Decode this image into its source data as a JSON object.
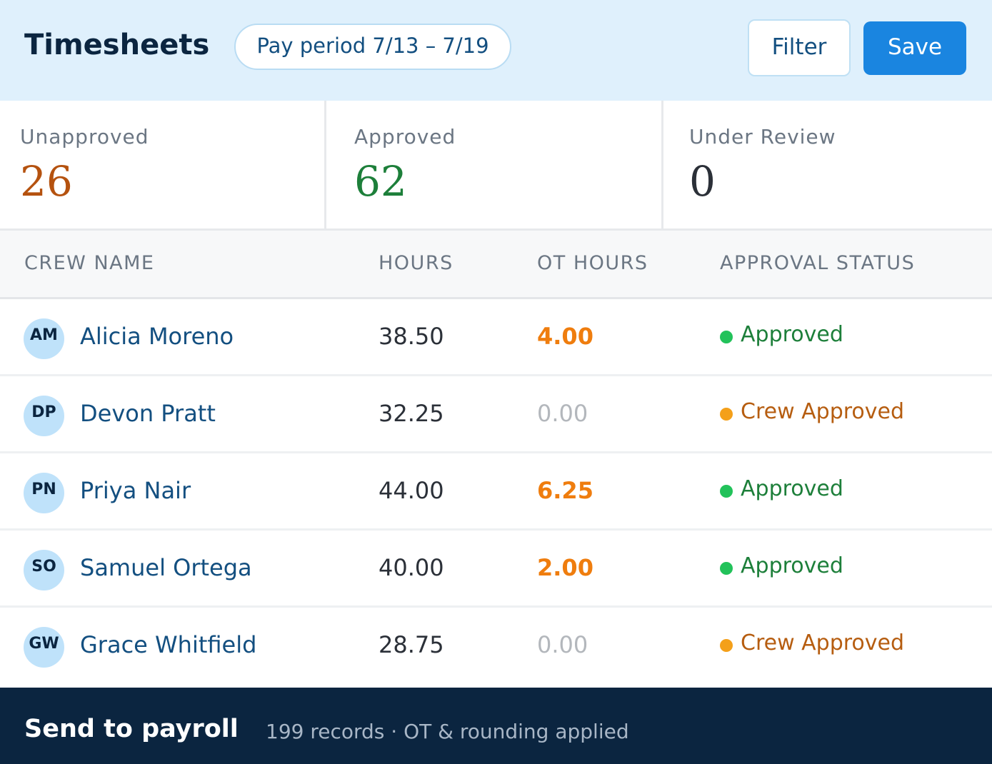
{
  "header": {
    "title": "Timesheets",
    "pay_period": "Pay period 7/13 – 7/19",
    "filter_label": "Filter",
    "save_label": "Save"
  },
  "stats": [
    {
      "label": "Unapproved",
      "value": "26",
      "color": "#b5520f"
    },
    {
      "label": "Approved",
      "value": "62",
      "color": "#1d7f3a"
    },
    {
      "label": "Under Review",
      "value": "0",
      "color": "#2b3038"
    }
  ],
  "table": {
    "columns": [
      "CREW NAME",
      "HOURS",
      "OT HOURS",
      "APPROVAL STATUS"
    ],
    "rows": [
      {
        "initials": "AM",
        "name": "Alicia Moreno",
        "hours": "38.50",
        "ot": "4.00",
        "status": "Approved"
      },
      {
        "initials": "DP",
        "name": "Devon Pratt",
        "hours": "32.25",
        "ot": "0.00",
        "status": "Crew Approved"
      },
      {
        "initials": "PN",
        "name": "Priya Nair",
        "hours": "44.00",
        "ot": "6.25",
        "status": "Approved"
      },
      {
        "initials": "SO",
        "name": "Samuel Ortega",
        "hours": "40.00",
        "ot": "2.00",
        "status": "Approved"
      },
      {
        "initials": "GW",
        "name": "Grace Whitfield",
        "hours": "28.75",
        "ot": "0.00",
        "status": "Crew Approved"
      }
    ]
  },
  "footer": {
    "title": "Send to payroll",
    "subtitle": "199 records · OT & rounding applied"
  },
  "colors": {
    "accent": "#1a85e0",
    "header_bg": "#dff0fc",
    "footer_bg": "#0b2540",
    "ot_highlight": "#ef7d0e",
    "approved": "#1d7f3a",
    "crew_approved": "#b65d10"
  }
}
